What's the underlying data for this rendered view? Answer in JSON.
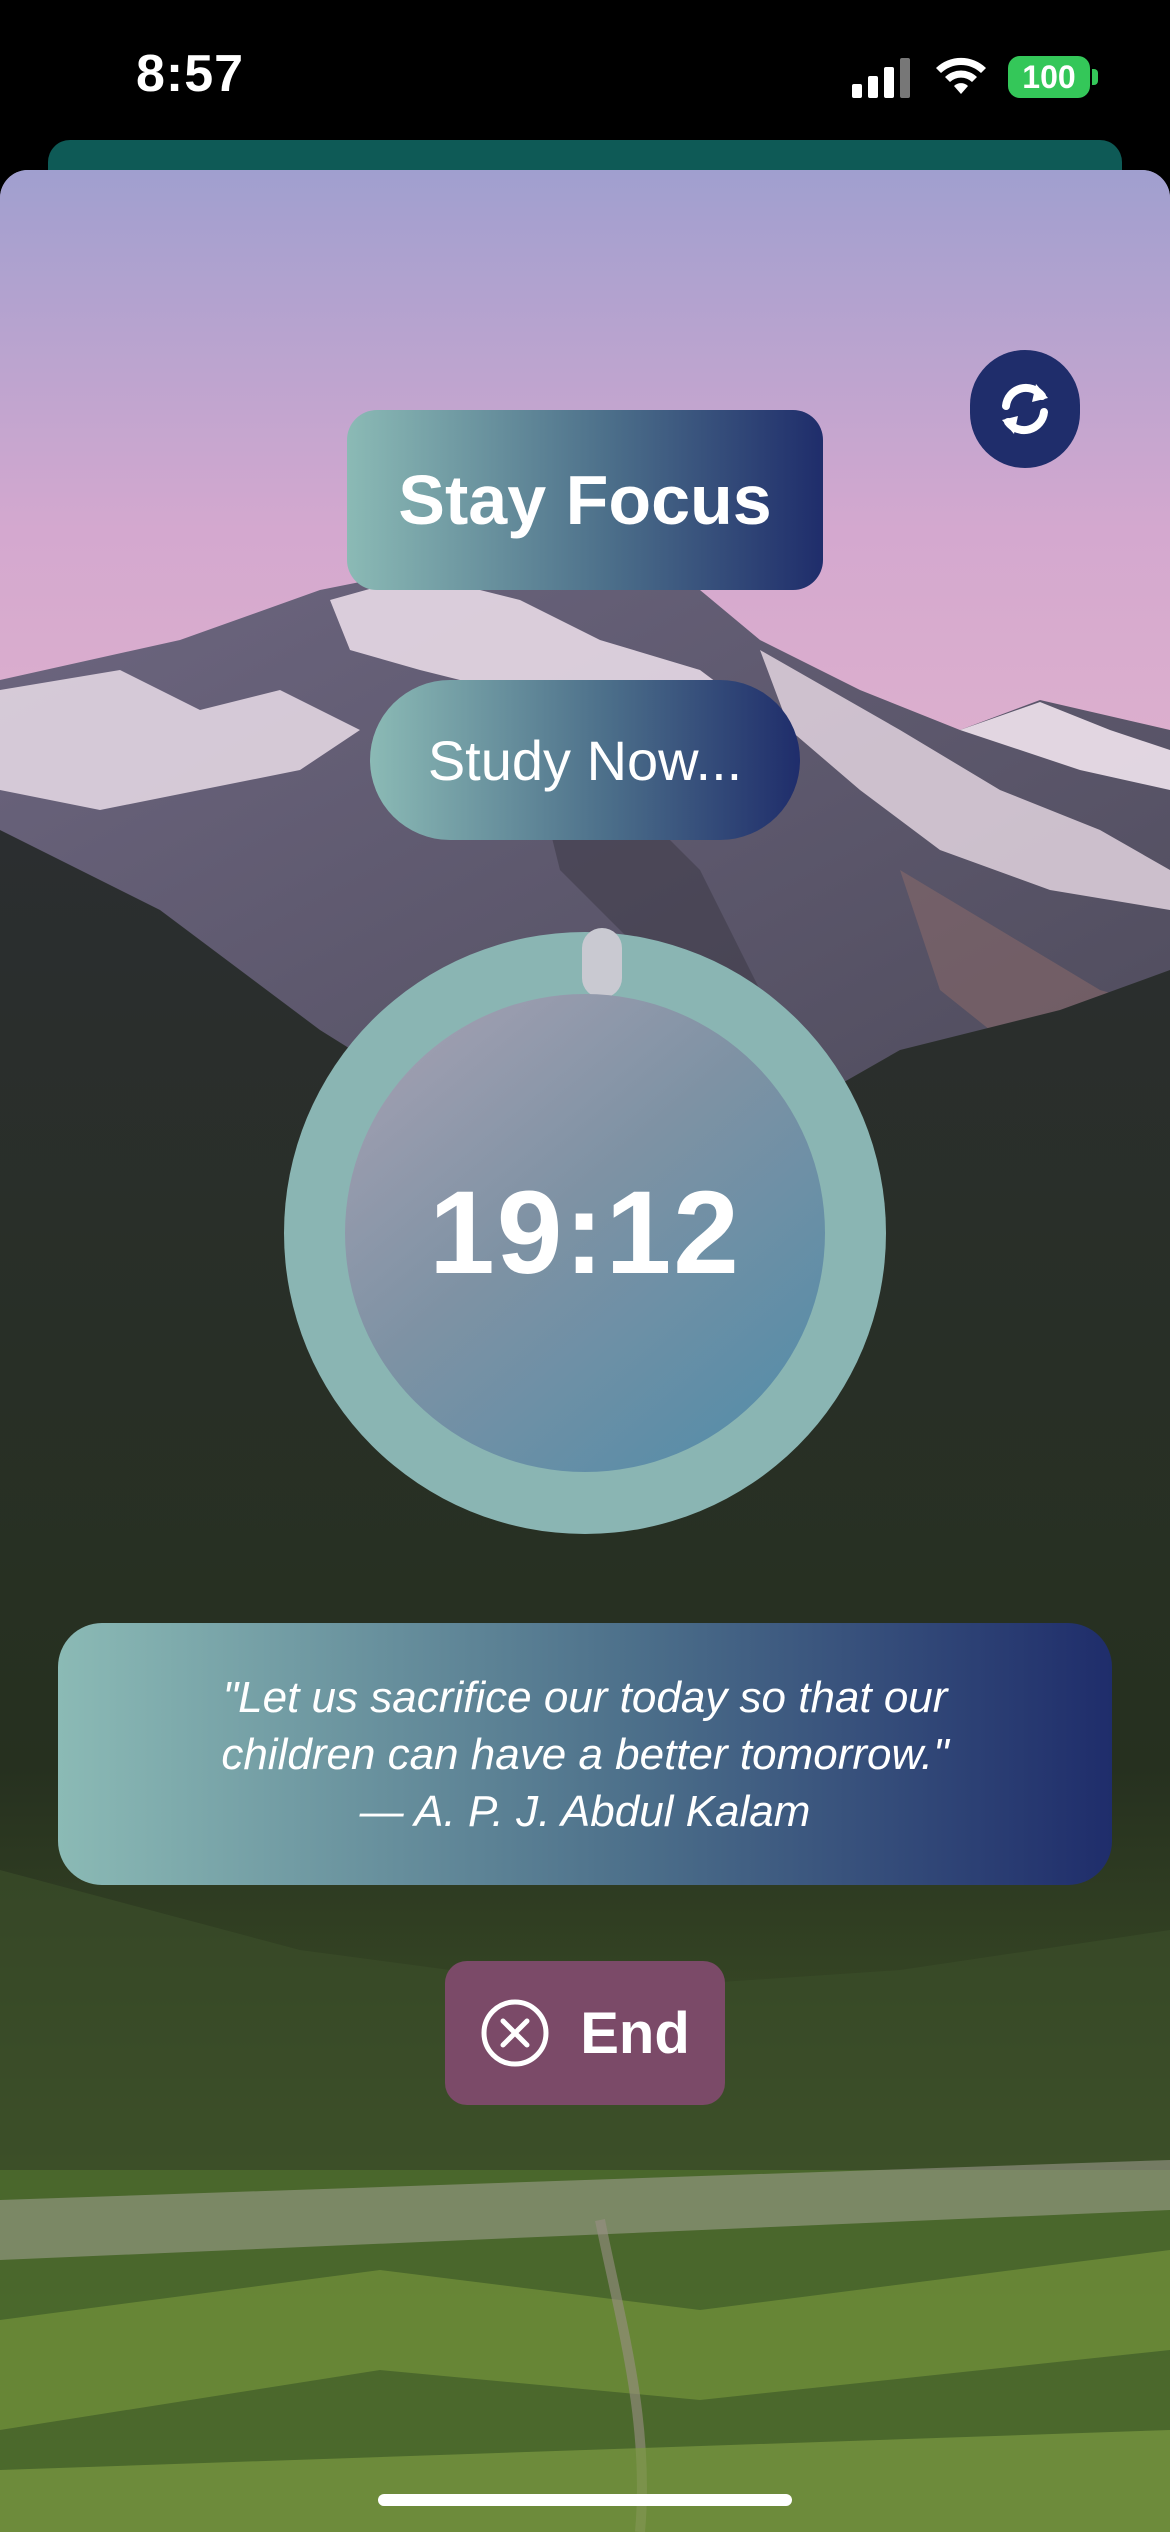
{
  "status_bar": {
    "time": "8:57",
    "battery": "100"
  },
  "header": {
    "title": "Stay Focus",
    "subtitle": "Study Now..."
  },
  "timer": {
    "remaining": "19:12"
  },
  "quote": {
    "line1": "\"Let us sacrifice our today so that our",
    "line2": "children can have a better tomorrow.\"",
    "author": "— A. P. J. Abdul Kalam"
  },
  "actions": {
    "end_label": "End"
  },
  "icons": {
    "refresh": "refresh-icon",
    "end": "close-circle-icon"
  },
  "colors": {
    "accent_dark": "#1f2d6b",
    "accent_teal": "#8ab5b3",
    "end_button": "#7b4a68"
  }
}
